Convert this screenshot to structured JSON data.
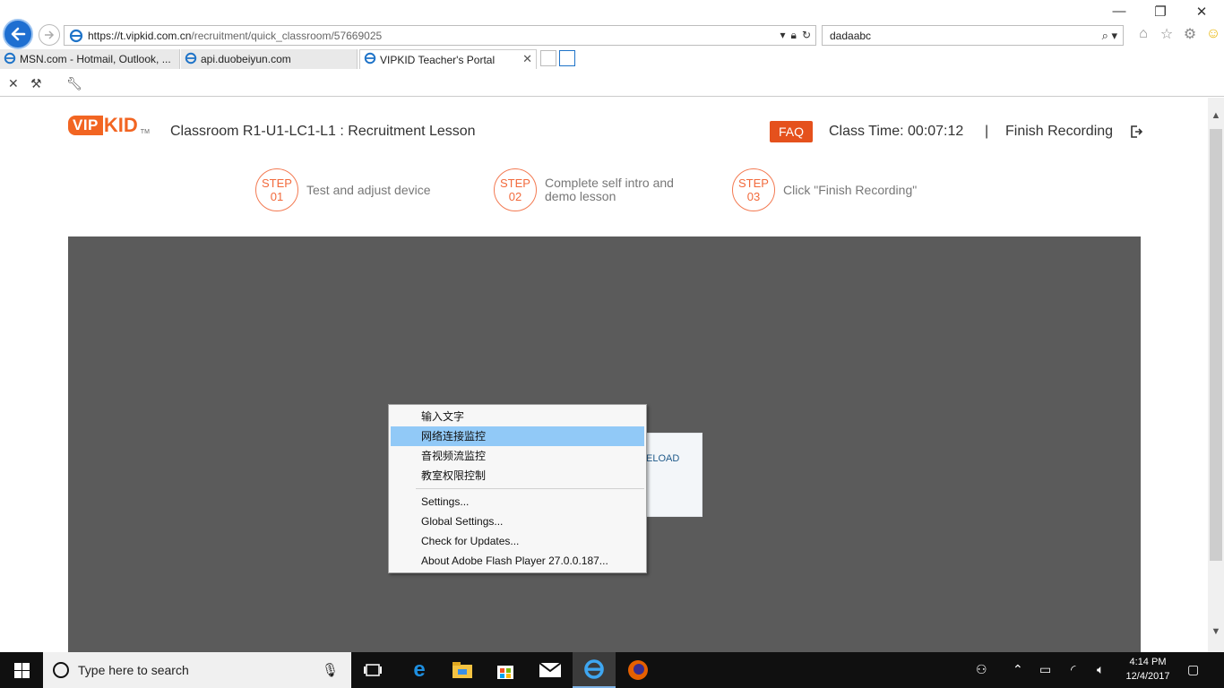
{
  "browser": {
    "url_host": "https://t.vipkid.com.cn",
    "url_path": "/recruitment/quick_classroom/57669025",
    "search_value": "dadaabc",
    "tabs": [
      {
        "label": "MSN.com - Hotmail, Outlook, ..."
      },
      {
        "label": "api.duobeiyun.com"
      },
      {
        "label": "VIPKID Teacher's Portal"
      }
    ]
  },
  "header": {
    "logo_vip": "VIP",
    "logo_kid": "KID",
    "logo_tm": "TM",
    "title": "Classroom R1-U1-LC1-L1 : Recruitment Lesson",
    "faq_label": "FAQ",
    "class_time": "Class Time: 00:07:12",
    "separator": "|",
    "finish_label": "Finish Recording"
  },
  "steps": [
    {
      "step_word": "STEP",
      "number": "01",
      "text_line1": "Test and adjust device",
      "text_line2": ""
    },
    {
      "step_word": "STEP",
      "number": "02",
      "text_line1": "Complete self intro and",
      "text_line2": "demo lesson"
    },
    {
      "step_word": "STEP",
      "number": "03",
      "text_line1": "Click \"Finish Recording\"",
      "text_line2": ""
    }
  ],
  "stage": {
    "reload_label": "ELOAD"
  },
  "context_menu": {
    "group1": [
      "输入文字",
      "网络连接监控",
      "音视频流监控",
      "教室权限控制"
    ],
    "group2": [
      "Settings...",
      "Global Settings...",
      "Check for Updates...",
      "About Adobe Flash Player 27.0.0.187..."
    ],
    "highlighted": "网络连接监控"
  },
  "taskbar": {
    "search_placeholder": "Type here to search",
    "time": "4:14 PM",
    "date": "12/4/2017"
  },
  "colors": {
    "brand_orange": "#f26522",
    "faq_bg": "#e5511d",
    "stage_bg": "#5b5b5b",
    "menu_highlight": "#91c9f7"
  }
}
